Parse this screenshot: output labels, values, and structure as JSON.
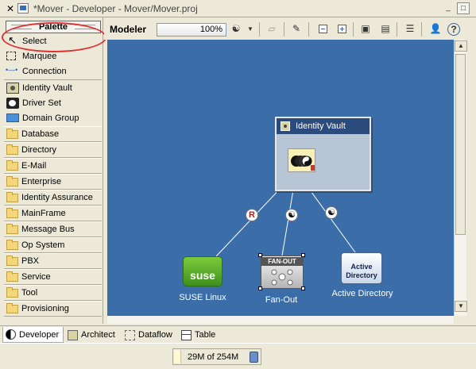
{
  "window": {
    "title": "*Mover - Developer - Mover/Mover.proj",
    "min_label": "_",
    "max_label": "□",
    "close_label": "✕"
  },
  "palette": {
    "header": "Palette",
    "tools": [
      {
        "label": "Select",
        "icon": "arrow-cursor-icon"
      },
      {
        "label": "Marquee",
        "icon": "marquee-icon"
      },
      {
        "label": "Connection",
        "icon": "connection-icon"
      }
    ],
    "objects": [
      {
        "label": "Identity Vault",
        "icon": "identity-vault-icon"
      },
      {
        "label": "Driver Set",
        "icon": "driver-set-icon"
      },
      {
        "label": "Domain Group",
        "icon": "domain-group-icon"
      }
    ],
    "drawers": [
      "Database",
      "Directory",
      "E-Mail",
      "Enterprise",
      "Identity Assurance",
      "MainFrame",
      "Message Bus",
      "Op System",
      "PBX",
      "Service",
      "Tool",
      "Provisioning"
    ]
  },
  "toolbar": {
    "modeler_label": "Modeler",
    "zoom": "100%"
  },
  "canvas": {
    "vault_title": "Identity Vault",
    "nodes": {
      "suse": {
        "caption": "SUSE Linux",
        "logo_text": "suse"
      },
      "fanout": {
        "caption": "Fan-Out",
        "logo_text": "FAN-OUT"
      },
      "ad": {
        "caption": "Active Directory",
        "logo_text": "Active Directory"
      }
    },
    "link_badges": [
      "R",
      "☯",
      "☯"
    ]
  },
  "bottom_tabs": [
    {
      "label": "Developer",
      "active": true
    },
    {
      "label": "Architect",
      "active": false
    },
    {
      "label": "Dataflow",
      "active": false
    },
    {
      "label": "Table",
      "active": false
    }
  ],
  "status": {
    "heap": "29M of 254M",
    "heap_used_fraction": 0.114
  }
}
